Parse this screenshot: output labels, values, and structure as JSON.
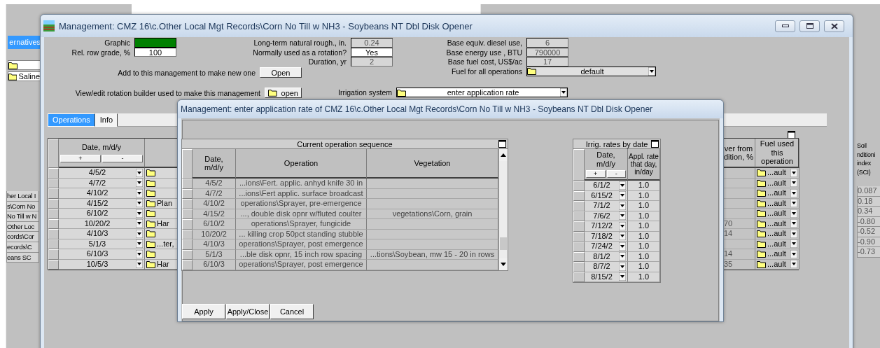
{
  "back_left": {
    "tab": "ernatives",
    "field": "Saline",
    "list": [
      "her Local I",
      "s\\Corn No",
      "No Till w N",
      "Other Loc",
      "cords\\Cor",
      "ecords\\C",
      "eans SC"
    ]
  },
  "back_right": {
    "header": [
      "Soil",
      "nditioni",
      "index",
      "(SCI)"
    ],
    "values": [
      "0.087",
      "0.18",
      "0.34",
      "-0.80",
      "-0.52",
      "-0.90",
      "-0.73"
    ]
  },
  "main_window": {
    "title": "Management:  CMZ 16\\c.Other Local Mgt Records\\Corn No Till w NH3 - Soybeans NT Dbl Disk Opener",
    "properties_left": [
      {
        "kind": "swatch",
        "label": "Graphic",
        "color": "#008000"
      },
      {
        "kind": "field",
        "label": "Rel. row grade, %",
        "value": "100",
        "disabled": false
      }
    ],
    "properties_middle": [
      {
        "kind": "field",
        "label": "Long-term natural rough., in.",
        "value": "0.24",
        "disabled": true
      },
      {
        "kind": "field",
        "label": "Normally used as a rotation?",
        "value": "Yes",
        "disabled": false
      },
      {
        "kind": "field",
        "label": "Duration, yr",
        "value": "2",
        "disabled": true
      }
    ],
    "properties_right": [
      {
        "kind": "field",
        "label": "Base equiv. diesel use,",
        "value": "6",
        "disabled": true
      },
      {
        "kind": "field",
        "label": "Base energy use , BTU",
        "value": "790000",
        "disabled": true
      },
      {
        "kind": "field",
        "label": "Base fuel cost, US$/ac",
        "value": "17",
        "disabled": true
      },
      {
        "kind": "dropdown",
        "label": "Fuel for all operations",
        "value": "default"
      }
    ],
    "new_from_this": {
      "label": "Add to this management to make new one",
      "button": "Open"
    },
    "rotation_builder": {
      "label": "View/edit rotation builder used to make this management",
      "button": "open"
    },
    "irrigation_system": {
      "label": "Irrigation system",
      "value": "enter application rate"
    },
    "tabs": [
      {
        "label": "Operations",
        "selected": true
      },
      {
        "label": "Info",
        "selected": false
      }
    ],
    "operations": {
      "date_header": "Date, m/d/y",
      "add": "+",
      "remove": "-",
      "cover_header": [
        "ver from",
        "dition, %"
      ],
      "fuel_header": [
        "Fuel used",
        "this",
        "operation"
      ],
      "rows": [
        {
          "date": "4/5/2",
          "fuel": "...ault"
        },
        {
          "date": "4/7/2",
          "fuel": "...ault"
        },
        {
          "date": "4/10/2",
          "fuel": "...ault"
        },
        {
          "date": "4/15/2",
          "operation": "Plan",
          "fuel": "...ault"
        },
        {
          "date": "6/10/2",
          "fuel": "...ault"
        },
        {
          "date": "10/20/2",
          "operation": "Har",
          "cover": "70",
          "fuel": "...ault"
        },
        {
          "date": "4/10/3",
          "cover": "14",
          "fuel": "...ault"
        },
        {
          "date": "5/1/3",
          "operation": "...ter,",
          "fuel": "...ault"
        },
        {
          "date": "6/10/3",
          "cover": "14",
          "fuel": "...ault"
        },
        {
          "date": "10/5/3",
          "operation": "Har",
          "cover": "35",
          "fuel": "...ault"
        }
      ]
    }
  },
  "dialog": {
    "title": "Management:  enter application rate of CMZ 16\\c.Other Local Mgt Records\\Corn No Till w NH3 - Soybeans NT Dbl Disk Opener",
    "sequence": {
      "title": "Current operation sequence",
      "columns": [
        [
          "Date,",
          "m/d/y"
        ],
        [
          "Operation"
        ],
        [
          "Vegetation"
        ]
      ],
      "rows": [
        {
          "date": "4/5/2",
          "operation": "...ions\\Fert. applic. anhyd knife 30 in"
        },
        {
          "date": "4/7/2",
          "operation": "...ions\\Fert applic. surface broadcast"
        },
        {
          "date": "4/10/2",
          "operation": "operations\\Sprayer, pre-emergence"
        },
        {
          "date": "4/15/2",
          "operation": "..., double disk opnr w/fluted coulter",
          "vegetation": "vegetations\\Corn, grain"
        },
        {
          "date": "6/10/2",
          "operation": "operations\\Sprayer, fungicide"
        },
        {
          "date": "10/20/2",
          "operation": "... killing crop 50pct standing stubble"
        },
        {
          "date": "4/10/3",
          "operation": "operations\\Sprayer, post emergence"
        },
        {
          "date": "5/1/3",
          "operation": "...ble disk opnr, 15 inch row spacing",
          "vegetation": "...tions\\Soybean, mw 15 - 20 in rows"
        },
        {
          "date": "6/10/3",
          "operation": "operations\\Sprayer, post emergence"
        }
      ]
    },
    "irrigation": {
      "title": "Irrig. rates by date",
      "date_header": [
        "Date,",
        "m/d/y"
      ],
      "add": "+",
      "remove": "-",
      "rate_header": [
        "Appl. rate",
        "that day,",
        "in/day"
      ],
      "rows": [
        {
          "date": "6/1/2",
          "rate": "1.0"
        },
        {
          "date": "6/15/2",
          "rate": "1.0"
        },
        {
          "date": "7/1/2",
          "rate": "1.0"
        },
        {
          "date": "7/6/2",
          "rate": "1.0"
        },
        {
          "date": "7/12/2",
          "rate": "1.0"
        },
        {
          "date": "7/18/2",
          "rate": "1.0"
        },
        {
          "date": "7/24/2",
          "rate": "1.0"
        },
        {
          "date": "8/1/2",
          "rate": "1.0"
        },
        {
          "date": "8/7/2",
          "rate": "1.0"
        },
        {
          "date": "8/15/2",
          "rate": "1.0"
        }
      ]
    },
    "buttons": [
      "Apply",
      "Apply/Close",
      "Cancel"
    ]
  }
}
